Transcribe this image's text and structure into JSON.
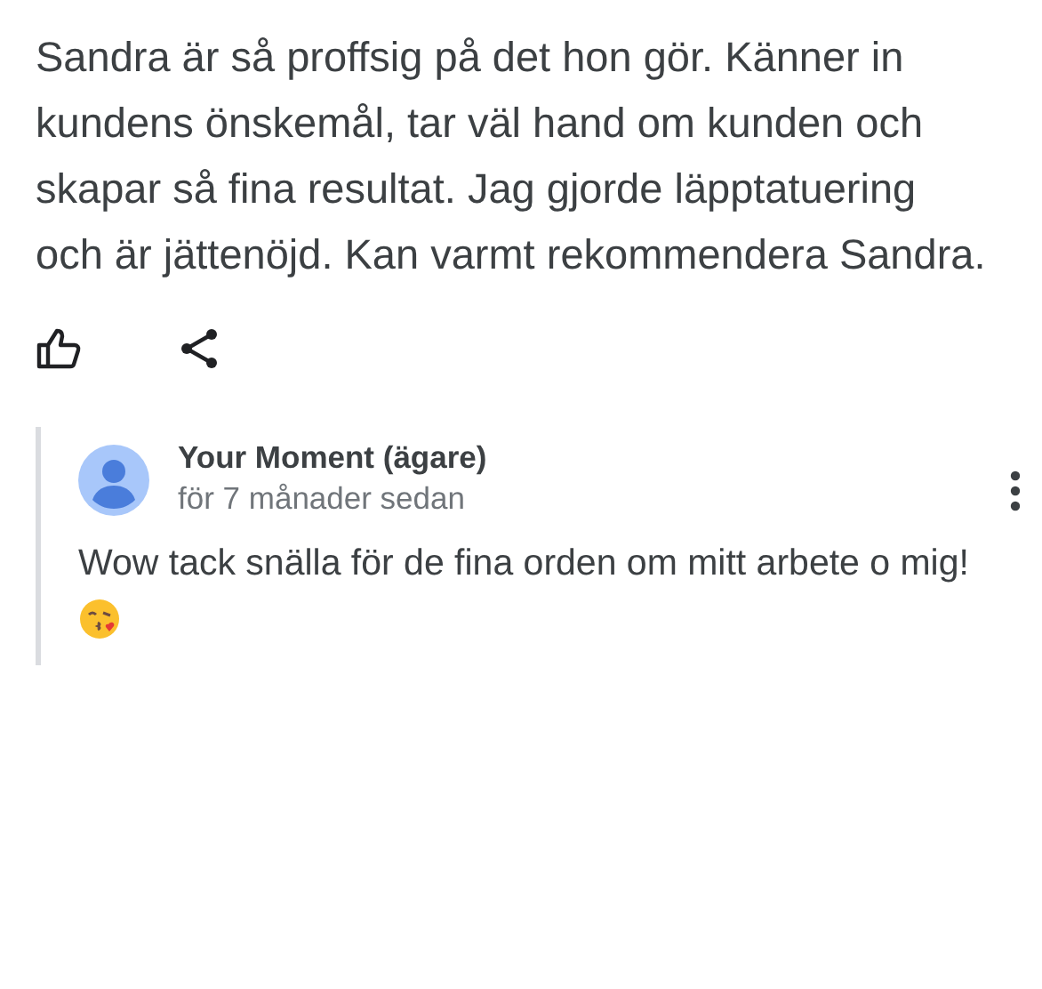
{
  "review": {
    "text": "Sandra är så proffsig på det hon gör. Känner in kundens önskemål, tar väl hand om kunden och skapar så fina resultat. Jag gjorde läpptatuering och är jättenöjd. Kan varmt rekommendera Sandra."
  },
  "reply": {
    "author": "Your Moment (ägare)",
    "time": "för 7 månader sedan",
    "text": "Wow tack snälla för de fina orden om mitt arbete o mig!"
  }
}
